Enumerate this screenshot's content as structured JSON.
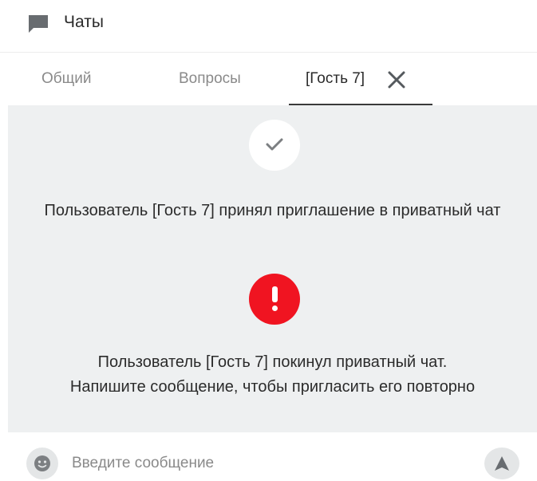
{
  "header": {
    "title": "Чаты",
    "icon": "chat-bubble-icon"
  },
  "tabs": [
    {
      "label": "Общий",
      "active": false
    },
    {
      "label": "Вопросы",
      "active": false
    },
    {
      "label": "[Гость 7]",
      "active": true,
      "closable": true
    }
  ],
  "messages": {
    "accepted": {
      "icon": "check-icon",
      "text": "Пользователь [Гость 7] принял приглашение в приватный чат"
    },
    "left": {
      "icon": "alert-icon",
      "line1": "Пользователь [Гость 7] покинул приватный чат.",
      "line2": "Напишите сообщение, чтобы пригласить его повторно"
    }
  },
  "composer": {
    "placeholder": "Введите сообщение",
    "emoji_icon": "emoji-icon",
    "send_icon": "send-icon"
  },
  "colors": {
    "background": "#eef0f1",
    "alert": "#f01421",
    "icon_gray": "#7c7f82",
    "text": "#2b2b2b",
    "muted": "#8a8a8a"
  }
}
